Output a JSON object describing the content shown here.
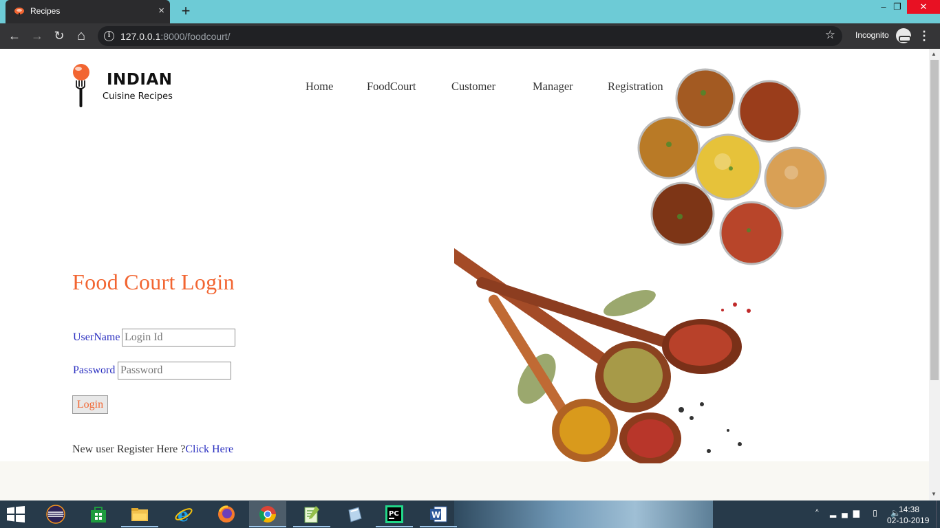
{
  "browser": {
    "tab_title": "Recipes",
    "tab_close": "×",
    "new_tab": "+",
    "url_host": "127.0.0.1",
    "url_path": ":8000/foodcourt/",
    "incognito_label": "Incognito",
    "window_controls": {
      "minimize": "–",
      "maximize": "❐",
      "close": "✕"
    },
    "toolbar": {
      "back": "←",
      "forward": "→",
      "reload": "↻",
      "home": "⌂",
      "star": "☆",
      "menu": "⋮",
      "info": "i"
    }
  },
  "site": {
    "brand": "INDIAN",
    "tagline": "Cuisine Recipes",
    "nav": [
      {
        "label": "Home"
      },
      {
        "label": "FoodCourt"
      },
      {
        "label": "Customer"
      },
      {
        "label": "Manager"
      },
      {
        "label": "Registration"
      }
    ],
    "login": {
      "title": "Food Court Login",
      "username_label": "UserName",
      "username_placeholder": "Login Id",
      "password_label": "Password",
      "password_placeholder": "Password",
      "button": "Login",
      "register_prefix": "New user Register Here ?",
      "register_link": "Click Here"
    }
  },
  "taskbar": {
    "apps": [
      "eclipse-icon",
      "store-icon",
      "file-explorer-icon",
      "internet-explorer-icon",
      "firefox-icon",
      "chrome-icon",
      "notepad-plus-icon",
      "virtualbox-icon",
      "pycharm-icon",
      "word-icon"
    ],
    "tray_arrow": "^",
    "tray": "📶 🔋 🔊",
    "time": "14:38",
    "date": "02-10-2019"
  },
  "colors": {
    "accent": "#f26531",
    "link": "#2a2fc0",
    "tabstrip": "#6dcbd6"
  }
}
